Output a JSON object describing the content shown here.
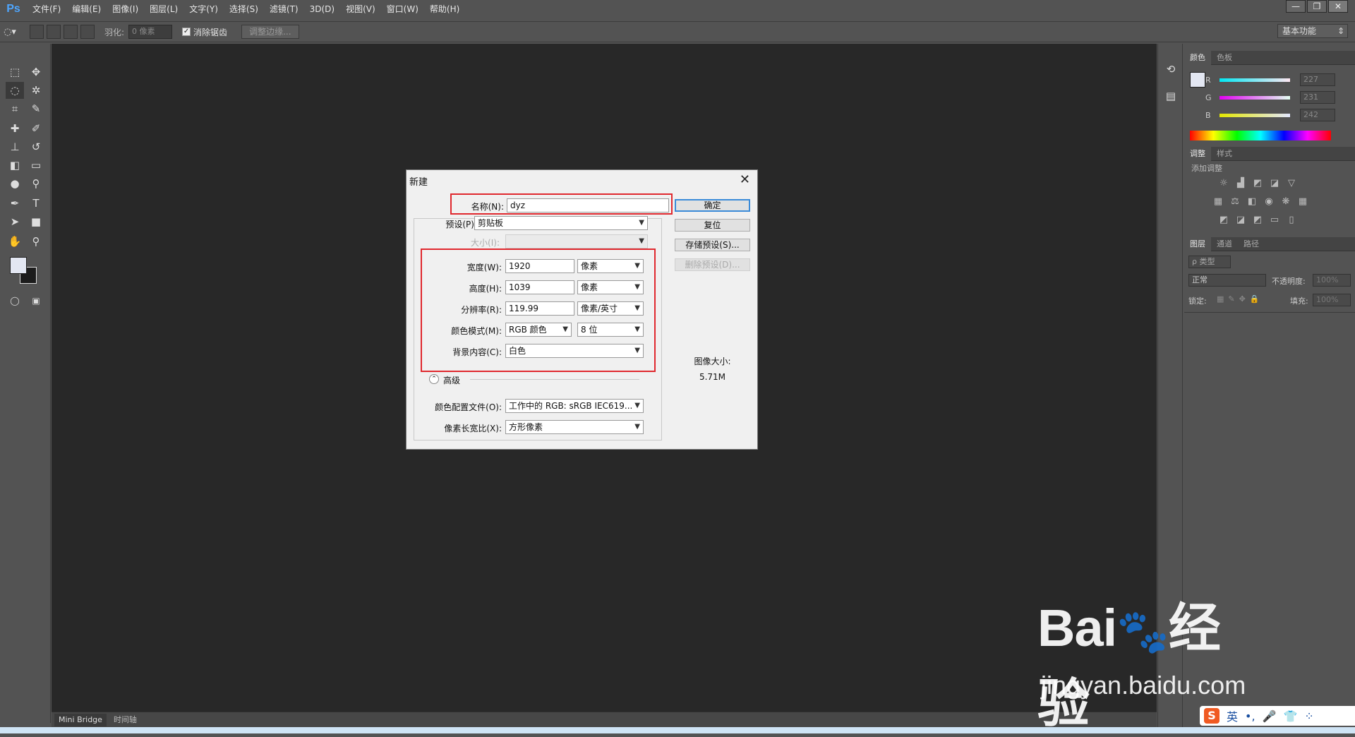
{
  "app": {
    "logo": "Ps",
    "menu": [
      "文件(F)",
      "编辑(E)",
      "图像(I)",
      "图层(L)",
      "文字(Y)",
      "选择(S)",
      "滤镜(T)",
      "3D(D)",
      "视图(V)",
      "窗口(W)",
      "帮助(H)"
    ],
    "window_controls": [
      "—",
      "❐",
      "✕"
    ]
  },
  "options_bar": {
    "feather_label": "羽化:",
    "feather_value": "0 像素",
    "antialias_label": "消除锯齿",
    "antialias_checked": true,
    "refine_edge_label": "调整边缘...",
    "workspace": "基本功能"
  },
  "tool_colors": {
    "foreground": "#e3e7f2",
    "background": "#1c1c1c"
  },
  "bottom_tabs": [
    "Mini Bridge",
    "时间轴"
  ],
  "color_panel": {
    "tabs": [
      "颜色",
      "色板"
    ],
    "r_label": "R",
    "r_value": "227",
    "g_label": "G",
    "g_value": "231",
    "b_label": "B",
    "b_value": "242"
  },
  "adjust_panel": {
    "tabs": [
      "调整",
      "样式"
    ],
    "add_label": "添加调整"
  },
  "layers_panel": {
    "tabs": [
      "图层",
      "通道",
      "路径"
    ],
    "filter_label": "ρ 类型",
    "blend_mode": "正常",
    "opacity_label": "不透明度:",
    "opacity_value": "100%",
    "lock_label": "锁定:",
    "fill_label": "填充:",
    "fill_value": "100%"
  },
  "dialog": {
    "title": "新建",
    "name_label": "名称(N):",
    "name_value": "dyz",
    "preset_label": "预设(P):",
    "preset_value": "剪贴板",
    "size_label": "大小(I):",
    "width_label": "宽度(W):",
    "width_value": "1920",
    "width_unit": "像素",
    "height_label": "高度(H):",
    "height_value": "1039",
    "height_unit": "像素",
    "resolution_label": "分辨率(R):",
    "resolution_value": "119.99",
    "resolution_unit": "像素/英寸",
    "color_mode_label": "颜色模式(M):",
    "color_mode_value": "RGB 颜色",
    "bit_depth": "8 位",
    "background_label": "背景内容(C):",
    "background_value": "白色",
    "advanced_label": "高级",
    "profile_label": "颜色配置文件(O):",
    "profile_value": "工作中的 RGB: sRGB IEC619...",
    "aspect_label": "像素长宽比(X):",
    "aspect_value": "方形像素",
    "ok_button": "确定",
    "reset_button": "复位",
    "save_preset_button": "存储预设(S)...",
    "delete_preset_button": "删除预设(D)...",
    "image_size_label": "图像大小:",
    "image_size_value": "5.71M"
  },
  "watermark": {
    "brand": "Bai du 经验",
    "url": "jingyan.baidu.com"
  },
  "ime": {
    "logo": "S",
    "lang": "英"
  }
}
